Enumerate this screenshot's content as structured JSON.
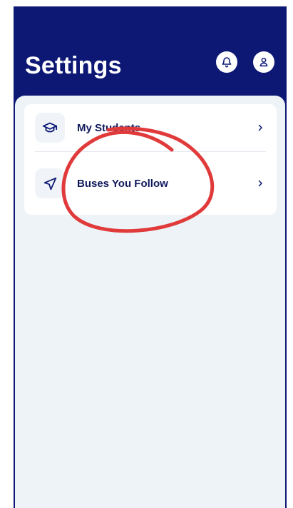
{
  "header": {
    "title": "Settings",
    "notification_icon": "bell-icon",
    "profile_icon": "user-icon"
  },
  "settings": {
    "items": [
      {
        "label": "My Students",
        "icon": "graduation-cap-icon",
        "trailing_icon": "chevron-right-icon"
      },
      {
        "label": "Buses You Follow",
        "icon": "navigation-arrow-icon",
        "trailing_icon": "chevron-right-icon"
      }
    ]
  },
  "colors": {
    "header_background": "#0c1874",
    "content_background": "#eef3f8",
    "card_background": "#ffffff",
    "primary_text": "#101a5b",
    "annotation": "#e03a3a"
  }
}
